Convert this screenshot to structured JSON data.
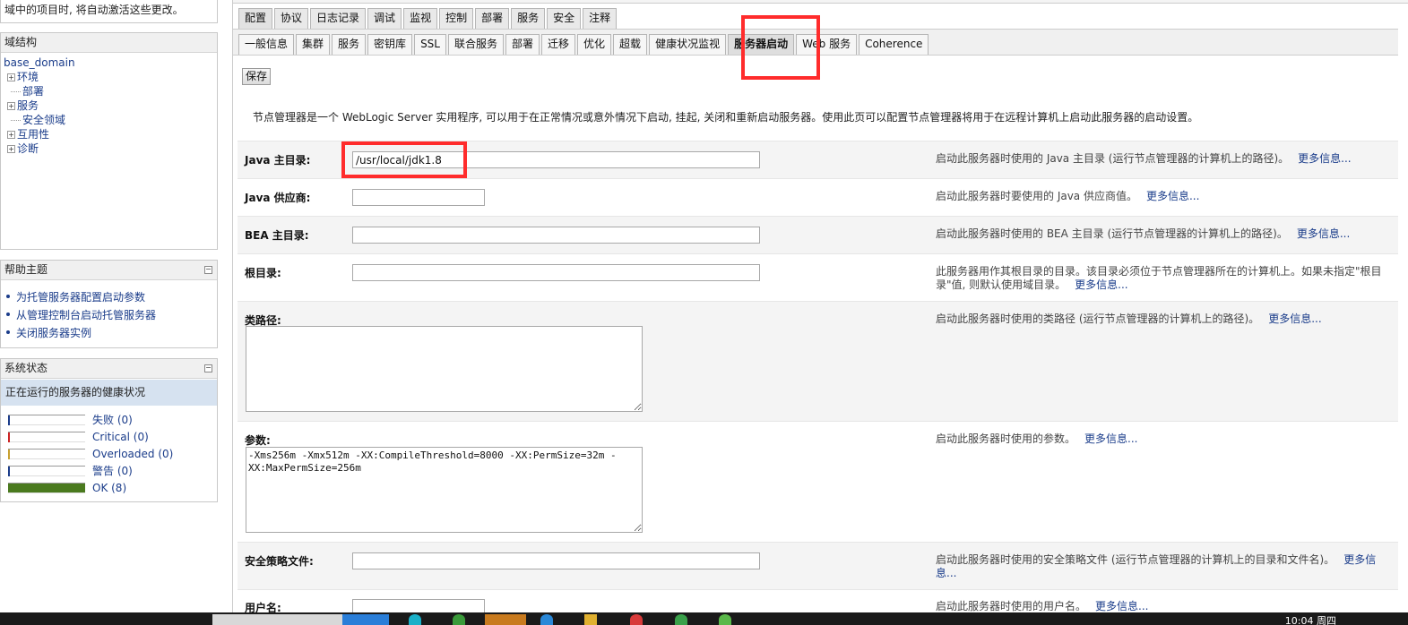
{
  "change_center": {
    "text": "域中的项目时, 将自动激活这些更改。"
  },
  "domain_structure": {
    "title": "域结构",
    "root": "base_domain",
    "items": [
      {
        "label": "环境",
        "expandable": true
      },
      {
        "label": "部署",
        "expandable": false
      },
      {
        "label": "服务",
        "expandable": true
      },
      {
        "label": "安全领域",
        "expandable": false
      },
      {
        "label": "互用性",
        "expandable": true
      },
      {
        "label": "诊断",
        "expandable": true
      }
    ]
  },
  "help_topics": {
    "title": "帮助主题",
    "items": [
      "为托管服务器配置启动参数",
      "从管理控制台启动托管服务器",
      "关闭服务器实例"
    ]
  },
  "system_status": {
    "title": "系统状态",
    "subtitle": "正在运行的服务器的健康状况",
    "rows": [
      {
        "label": "失败 (0)",
        "color": "#1a3c8a",
        "fill": 0
      },
      {
        "label": "Critical (0)",
        "color": "#cc2222",
        "fill": 0
      },
      {
        "label": "Overloaded (0)",
        "color": "#c8a030",
        "fill": 0
      },
      {
        "label": "警告 (0)",
        "color": "#1a3c8a",
        "fill": 0
      },
      {
        "label": "OK (8)",
        "color": "#4a7a1e",
        "fill": 1
      }
    ]
  },
  "tabs_main": [
    "配置",
    "协议",
    "日志记录",
    "调试",
    "监视",
    "控制",
    "部署",
    "服务",
    "安全",
    "注释"
  ],
  "tabs_sub": [
    "一般信息",
    "集群",
    "服务",
    "密钥库",
    "SSL",
    "联合服务",
    "部署",
    "迁移",
    "优化",
    "超载",
    "健康状况监视",
    "服务器启动",
    "Web 服务",
    "Coherence"
  ],
  "save_label": "保存",
  "intro": "节点管理器是一个 WebLogic Server 实用程序, 可以用于在正常情况或意外情况下启动, 挂起, 关闭和重新启动服务器。使用此页可以配置节点管理器将用于在远程计算机上启动此服务器的启动设置。",
  "more_info": "更多信息...",
  "fields": {
    "java_home": {
      "label": "Java 主目录:",
      "value": "/usr/local/jdk1.8",
      "desc": "启动此服务器时使用的 Java 主目录 (运行节点管理器的计算机上的路径)。"
    },
    "java_vendor": {
      "label": "Java 供应商:",
      "value": "",
      "desc": "启动此服务器时要使用的 Java 供应商值。"
    },
    "bea_home": {
      "label": "BEA 主目录:",
      "value": "",
      "desc": "启动此服务器时使用的 BEA 主目录 (运行节点管理器的计算机上的路径)。"
    },
    "root_dir": {
      "label": "根目录:",
      "value": "",
      "desc": "此服务器用作其根目录的目录。该目录必须位于节点管理器所在的计算机上。如果未指定\"根目录\"值, 则默认使用域目录。"
    },
    "class_path": {
      "label": "类路径:",
      "value": "",
      "desc": "启动此服务器时使用的类路径 (运行节点管理器的计算机上的路径)。"
    },
    "arguments": {
      "label": "参数:",
      "value": "-Xms256m -Xmx512m -XX:CompileThreshold=8000 -XX:PermSize=32m -XX:MaxPermSize=256m",
      "desc": "启动此服务器时使用的参数。"
    },
    "security_policy": {
      "label": "安全策略文件:",
      "value": "",
      "desc": "启动此服务器时使用的安全策略文件 (运行节点管理器的计算机上的目录和文件名)。"
    },
    "username": {
      "label": "用户名:",
      "value": "",
      "desc": "启动此服务器时使用的用户名。"
    }
  },
  "taskbar": {
    "clock": "10:04 周四"
  }
}
